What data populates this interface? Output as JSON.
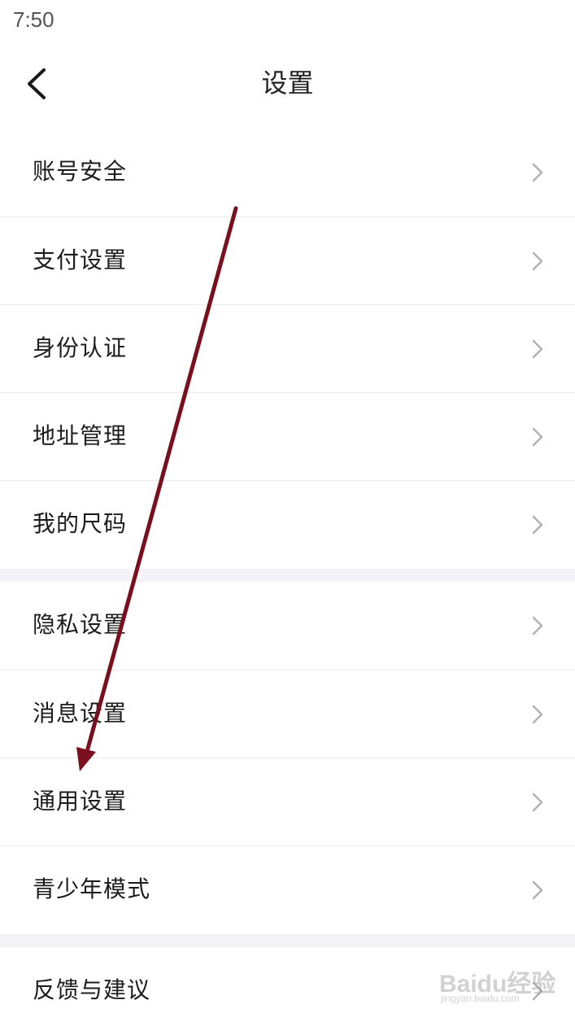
{
  "status_bar": {
    "time": "7:50"
  },
  "header": {
    "title": "设置",
    "back_icon": "chevron-left-icon"
  },
  "groups": [
    {
      "items": [
        {
          "label": "账号安全"
        },
        {
          "label": "支付设置"
        },
        {
          "label": "身份认证"
        },
        {
          "label": "地址管理"
        },
        {
          "label": "我的尺码"
        }
      ]
    },
    {
      "items": [
        {
          "label": "隐私设置"
        },
        {
          "label": "消息设置"
        },
        {
          "label": "通用设置"
        },
        {
          "label": "青少年模式"
        }
      ]
    },
    {
      "items": [
        {
          "label": "反馈与建议"
        }
      ]
    }
  ],
  "annotation": {
    "arrow_color": "#7a0f1e",
    "target_item": "通用设置"
  },
  "watermark": {
    "brand": "Baidu经验",
    "url": "jingyan.baidu.com"
  },
  "colors": {
    "section_gap": "#f4f4f8",
    "divider": "#ebebeb",
    "chevron": "#b0b0b0"
  }
}
